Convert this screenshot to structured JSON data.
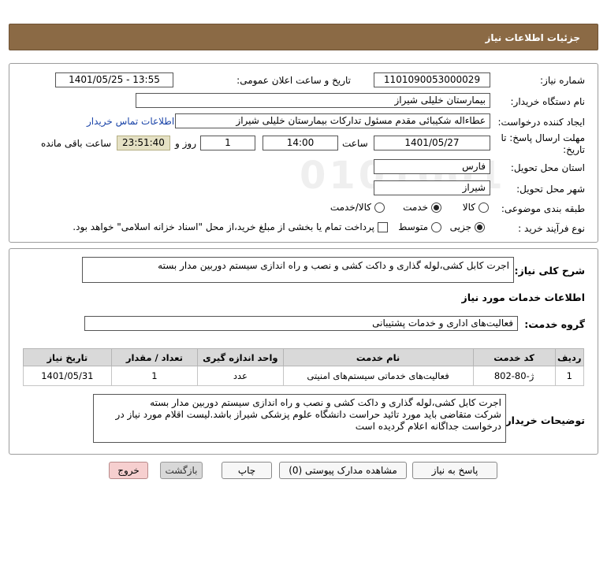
{
  "header": {
    "title": "جزئیات اطلاعات نیاز"
  },
  "form": {
    "need_number_label": "شماره نیاز:",
    "need_number": "1101090053000029",
    "announce_label": "تاریخ و ساعت اعلان عمومی:",
    "announce_value": "1401/05/25 - 13:55",
    "buyer_org_label": "نام دستگاه خریدار:",
    "buyer_org": "بیمارستان خلیلی شیراز",
    "requester_label": "ایجاد کننده درخواست:",
    "requester": "عطاءاله شکیبائی مقدم مسئول تدارکات  بیمارستان خلیلی شیراز",
    "contact_link": "اطلاعات تماس خریدار",
    "deadline_label_line1": "مهلت ارسال پاسخ: تا",
    "deadline_label_line2": "تاریخ:",
    "deadline_date": "1401/05/27",
    "time_label": "ساعت",
    "deadline_time": "14:00",
    "days_value": "1",
    "days_label": "روز و",
    "remaining_timer": "23:51:40",
    "remaining_label": "ساعت باقی مانده",
    "province_label": "استان محل تحویل:",
    "province": "فارس",
    "city_label": "شهر محل تحویل:",
    "city": "شیراز",
    "category_label": "طبقه بندی موضوعی:",
    "category_options": [
      {
        "label": "کالا",
        "selected": false
      },
      {
        "label": "خدمت",
        "selected": true
      },
      {
        "label": "کالا/خدمت",
        "selected": false
      }
    ],
    "purchase_label": "نوع فرآیند خرید :",
    "purchase_options": [
      {
        "label": "جزیی",
        "selected": true
      },
      {
        "label": "متوسط",
        "selected": false
      }
    ],
    "payment_note": "پرداخت تمام یا بخشی از مبلغ خرید،از محل \"اسناد خزانه اسلامی\" خواهد بود."
  },
  "details": {
    "summary_label": "شرح کلی نیاز:",
    "summary": "اجرت کابل کشی،لوله گذاری و داکت کشی و نصب و راه اندازی سیستم دوربین مدار بسته",
    "services_heading": "اطلاعات خدمات مورد نیاز",
    "service_group_label": "گروه خدمت:",
    "service_group": "فعالیت‌های اداری و خدمات پشتیبانی",
    "table": {
      "headers": [
        "ردیف",
        "کد خدمت",
        "نام خدمت",
        "واحد اندازه گیری",
        "تعداد / مقدار",
        "تاریخ نیاز"
      ],
      "rows": [
        [
          "1",
          "ژ-80-802",
          "فعالیت‌های خدماتی سیستم‌های امنیتی",
          "عدد",
          "1",
          "1401/05/31"
        ]
      ]
    },
    "buyer_notes_label": "توضیحات خریدار:",
    "buyer_notes": [
      "اجرت کابل کشی،لوله گذاری و داکت کشی و نصب و راه اندازی سیستم دوربین مدار بسته",
      "شرکت متقاضی باید مورد تائید حراست دانشگاه علوم پزشکی شیراز باشد.لیست اقلام مورد نیاز در",
      "درخواست جداگانه اعلام گردیده است"
    ]
  },
  "buttons": {
    "reply": "پاسخ به نیاز",
    "attachments": "مشاهده مدارک پیوستی (0)",
    "print": "چاپ",
    "back": "بازگشت",
    "exit": "خروج"
  },
  "watermark": {
    "brand": "ParsNamadData",
    "digits": "0101001"
  }
}
